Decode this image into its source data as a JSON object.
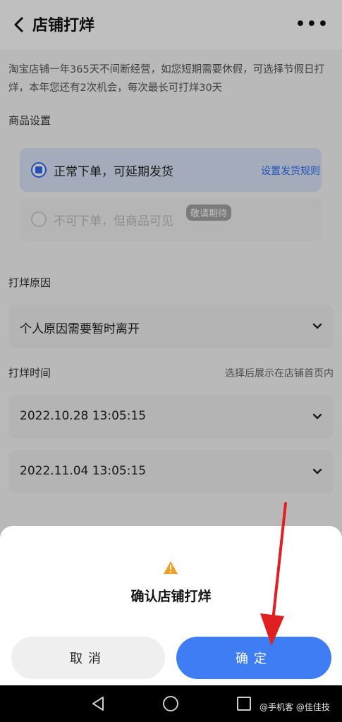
{
  "header": {
    "title": "店铺打烊",
    "more": "•••"
  },
  "intro": "淘宝店铺一年365天不间断经营，如您短期需要休假，可选择节假日打烊，本年您还有2次机会，每次最长可打烊30天",
  "product_settings": {
    "label": "商品设置",
    "options": [
      {
        "label": "正常下单，可延期发货",
        "link": "设置发货规则",
        "selected": true
      },
      {
        "label": "不可下单，但商品可见",
        "badge": "敬请期待",
        "selected": false
      }
    ]
  },
  "reason": {
    "label": "打烊原因",
    "value": "个人原因需要暂时离开"
  },
  "time": {
    "label": "打烊时间",
    "hint": "选择后展示在店铺首页内",
    "start": "2022.10.28 13:05:15",
    "end": "2022.11.04 13:05:15"
  },
  "dialog": {
    "title": "确认店铺打烊",
    "cancel": "取消",
    "confirm": "确定"
  },
  "watermark": "@手机客 @佳佳技",
  "colors": {
    "accent": "#3f7df5",
    "warning": "#f0a020",
    "arrow": "#e02020"
  }
}
